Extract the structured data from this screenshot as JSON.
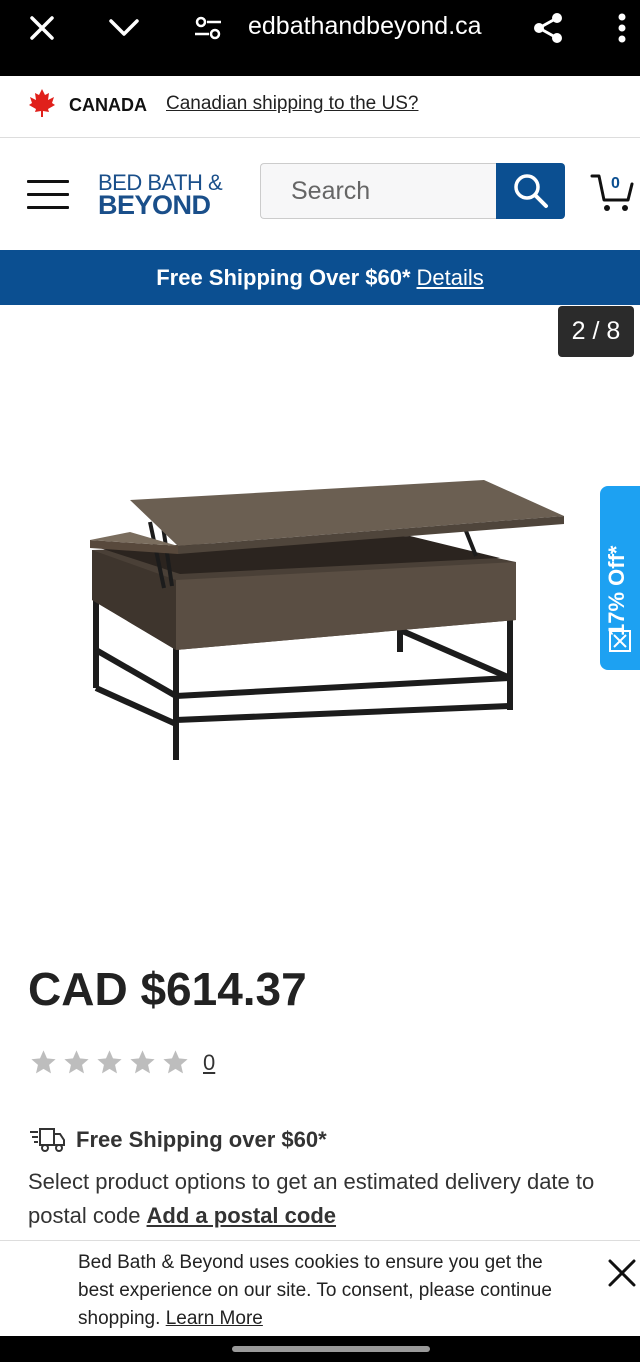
{
  "browser": {
    "url": "edbathandbeyond.ca",
    "icons": [
      "close-icon",
      "chevron-down-icon",
      "site-settings-icon",
      "share-icon",
      "more-vert-icon"
    ]
  },
  "country_bar": {
    "country": "CANADA",
    "link": "Canadian shipping to the US?"
  },
  "header": {
    "logo_top": "BED BATH &",
    "logo_bottom": "BEYOND",
    "search_placeholder": "Search",
    "cart_count": "0"
  },
  "shipping_banner": {
    "text": "Free Shipping Over $60*",
    "link": "Details"
  },
  "gallery": {
    "counter": "2 / 8",
    "discount_tab": "17% Off*"
  },
  "product": {
    "price": "CAD $614.37",
    "rating": 0,
    "rating_max": 5,
    "review_count": "0",
    "free_shipping": "Free Shipping over $60*",
    "delivery_text": "Select product options to get an estimated delivery date to postal code",
    "postal_link": "Add a postal code"
  },
  "cookie_banner": {
    "text": "Bed Bath & Beyond uses cookies to ensure you get the best experience on our site. To consent, please continue shopping.",
    "link": "Learn More"
  },
  "colors": {
    "brand_blue": "#0b4f91",
    "discount_blue": "#1da1f2",
    "star_gray": "#bdbdbd"
  }
}
